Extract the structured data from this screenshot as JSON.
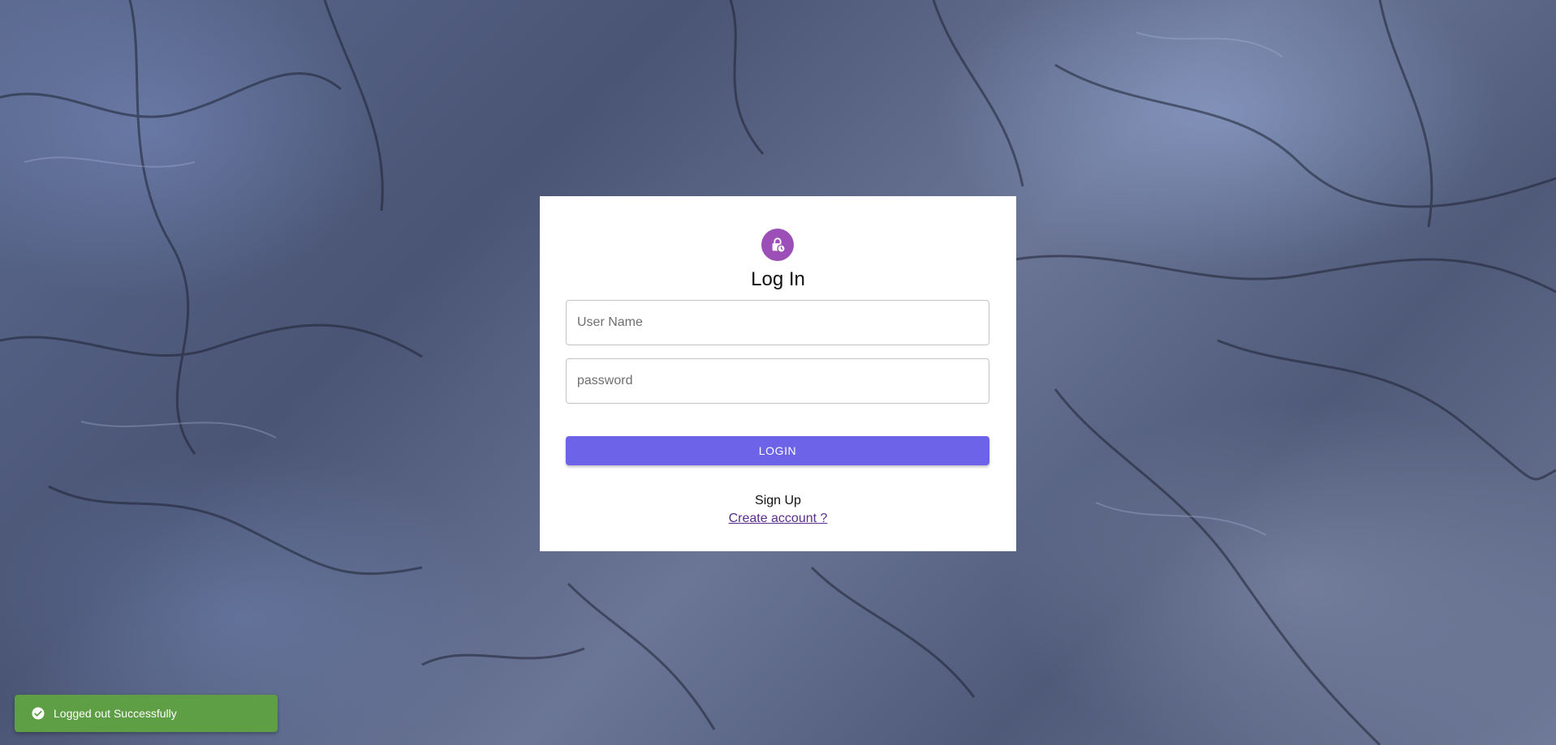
{
  "login": {
    "title": "Log In",
    "username_placeholder": "User Name",
    "password_placeholder": "password",
    "login_button": "LOGIN",
    "signup_label": "Sign Up",
    "create_account_link": "Create account ?",
    "icon": "lock-clock-icon"
  },
  "toast": {
    "message": "Logged out Successfully",
    "icon": "check-circle-icon",
    "status": "success"
  },
  "colors": {
    "avatar": "#9c4fb7",
    "login_button": "#6c63e8",
    "toast_success": "#5e9f45",
    "link": "#5a2d91"
  }
}
